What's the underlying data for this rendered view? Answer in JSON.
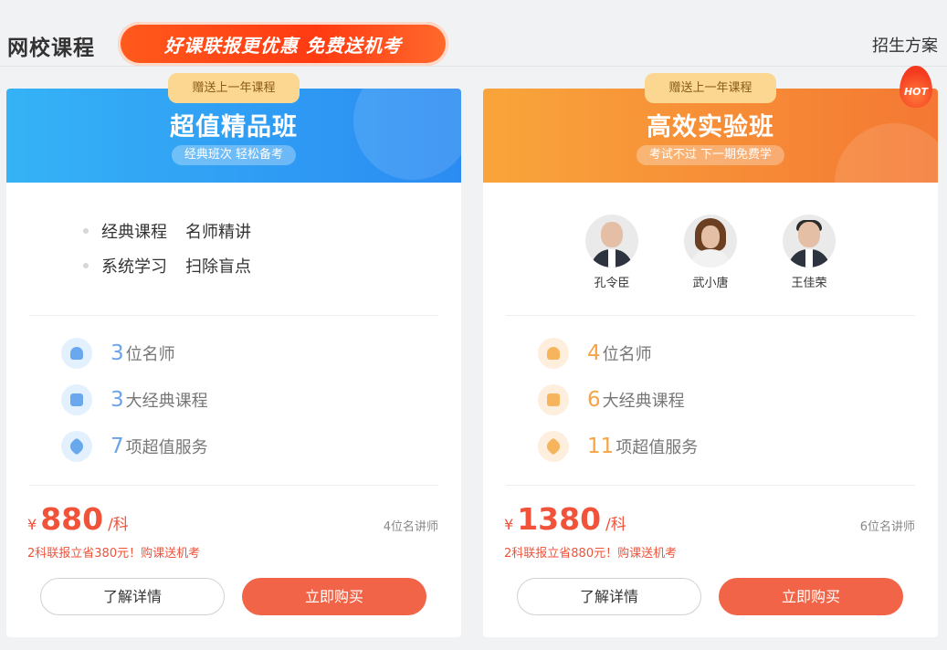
{
  "header": {
    "title": "网校课程",
    "promo_banner": "好课联报更优惠 免费送机考",
    "plan_link": "招生方案"
  },
  "cards": [
    {
      "ribbon": "赠送上一年课程",
      "name": "超值精品班",
      "subtitle": "经典班次 轻松备考",
      "theme_color": "#2b8bf2",
      "features": [
        {
          "a": "经典课程",
          "b": "名师精讲"
        },
        {
          "a": "系统学习",
          "b": "扫除盲点"
        }
      ],
      "stats": [
        {
          "icon": "teacher-icon",
          "num": "3",
          "label": "位名师"
        },
        {
          "icon": "course-book-icon",
          "num": "3",
          "label": "大经典课程"
        },
        {
          "icon": "heart-service-icon",
          "num": "7",
          "label": "项超值服务"
        }
      ],
      "price": {
        "currency": "¥",
        "value": "880",
        "unit": "/科"
      },
      "lecturers": "4位名讲师",
      "promo": "2科联报立省380元！购课送机考",
      "detail_label": "了解详情",
      "buy_label": "立即购买"
    },
    {
      "ribbon": "赠送上一年课程",
      "name": "高效实验班",
      "subtitle": "考试不过 下一期免费学",
      "hot_badge": "HOT",
      "theme_color": "#f47833",
      "teachers": [
        {
          "name": "孔令臣"
        },
        {
          "name": "武小唐"
        },
        {
          "name": "王佳荣"
        }
      ],
      "stats": [
        {
          "icon": "teacher-icon",
          "num": "4",
          "label": "位名师"
        },
        {
          "icon": "course-book-icon",
          "num": "6",
          "label": "大经典课程"
        },
        {
          "icon": "heart-service-icon",
          "num": "11",
          "label": "项超值服务"
        }
      ],
      "price": {
        "currency": "¥",
        "value": "1380",
        "unit": "/科"
      },
      "lecturers": "6位名讲师",
      "promo": "2科联报立省880元！购课送机考",
      "detail_label": "了解详情",
      "buy_label": "立即购买"
    }
  ]
}
